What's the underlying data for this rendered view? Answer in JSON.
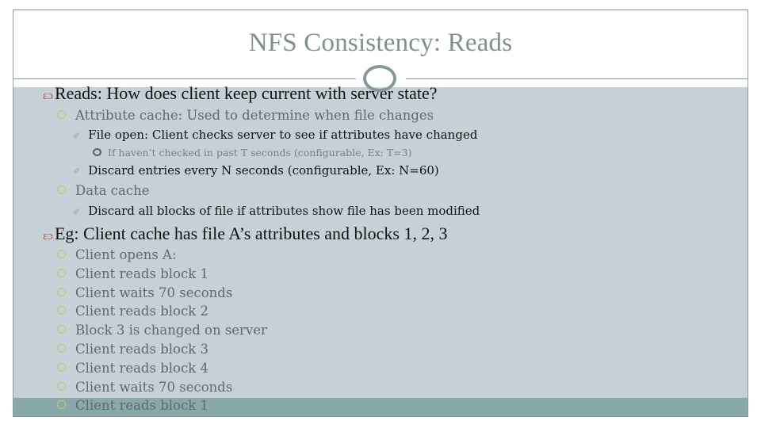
{
  "slide": {
    "title": "NFS Consistency: Reads",
    "colors": {
      "title": "#7f9090",
      "content_bg": "#c6d0d7",
      "footer_bg": "#88a9a9",
      "level1_bullet": "#b35a4d",
      "level2_bullet": "#c6c56a"
    },
    "bullets": [
      {
        "level": 1,
        "icon": "scroll-bullet-icon",
        "text": "Reads: How does client keep current with server state?"
      },
      {
        "level": 2,
        "icon": "circle-bullet-icon",
        "text": "Attribute cache: Used to determine when file changes"
      },
      {
        "level": 3,
        "icon": "pencil-bullet-icon",
        "text": "File open: Client checks server to see if attributes have changed"
      },
      {
        "level": 4,
        "icon": "ring-bullet-icon",
        "text": "If haven’t checked in past T seconds (configurable, Ex: T=3)"
      },
      {
        "level": 3,
        "icon": "pencil-bullet-icon",
        "text": "Discard entries every N seconds (configurable, Ex: N=60)"
      },
      {
        "level": 2,
        "icon": "circle-bullet-icon",
        "text": "Data cache"
      },
      {
        "level": 3,
        "icon": "pencil-bullet-icon",
        "text": "Discard all blocks of file if attributes show file has been modified"
      },
      {
        "level": 1,
        "icon": "scroll-bullet-icon",
        "text": "Eg: Client cache has file A’s attributes and blocks 1, 2, 3"
      },
      {
        "level": 2,
        "icon": "circle-bullet-icon",
        "text": "Client opens A:"
      },
      {
        "level": 2,
        "icon": "circle-bullet-icon",
        "text": "Client reads block 1"
      },
      {
        "level": 2,
        "icon": "circle-bullet-icon",
        "text": "Client waits 70 seconds"
      },
      {
        "level": 2,
        "icon": "circle-bullet-icon",
        "text": "Client reads block 2"
      },
      {
        "level": 2,
        "icon": "circle-bullet-icon",
        "text": "Block 3 is changed on server"
      },
      {
        "level": 2,
        "icon": "circle-bullet-icon",
        "text": "Client reads block 3"
      },
      {
        "level": 2,
        "icon": "circle-bullet-icon",
        "text": "Client reads block 4"
      },
      {
        "level": 2,
        "icon": "circle-bullet-icon",
        "text": "Client waits 70 seconds"
      },
      {
        "level": 2,
        "icon": "circle-bullet-icon",
        "text": "Client reads block 1"
      }
    ],
    "bullet_glyphs": {
      "level1": "ဢ",
      "level3": "✎"
    }
  }
}
